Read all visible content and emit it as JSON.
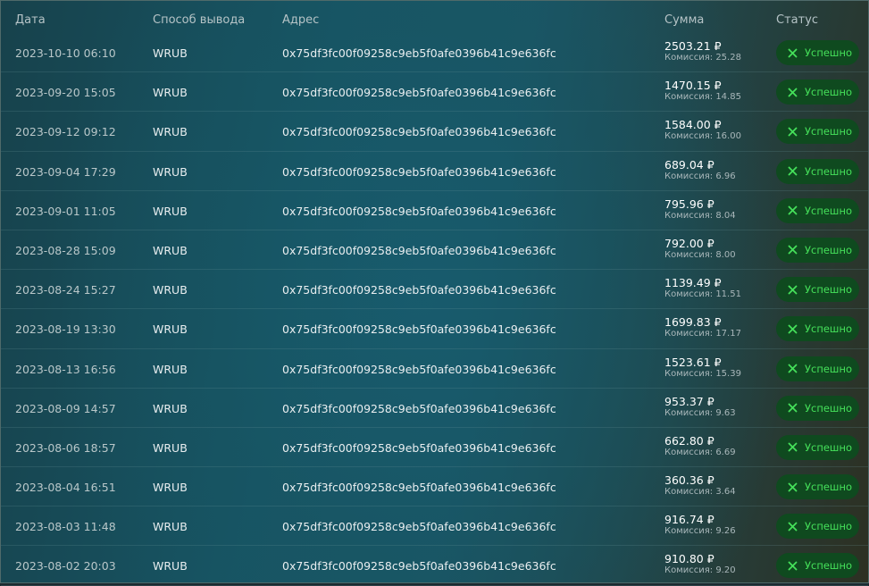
{
  "table": {
    "headers": {
      "date": "Дата",
      "method": "Способ вывода",
      "address": "Адрес",
      "amount": "Сумма",
      "status": "Статус"
    },
    "rows": [
      {
        "date": "2023-10-10 06:10",
        "method": "WRUB",
        "address": "0x75df3fc00f09258c9eb5f0afe0396b41c9e636fc",
        "amount": "2503.21 ₽",
        "fee": "Комиссия: 25.28",
        "status": "Успешно"
      },
      {
        "date": "2023-09-20 15:05",
        "method": "WRUB",
        "address": "0x75df3fc00f09258c9eb5f0afe0396b41c9e636fc",
        "amount": "1470.15 ₽",
        "fee": "Комиссия: 14.85",
        "status": "Успешно"
      },
      {
        "date": "2023-09-12 09:12",
        "method": "WRUB",
        "address": "0x75df3fc00f09258c9eb5f0afe0396b41c9e636fc",
        "amount": "1584.00 ₽",
        "fee": "Комиссия: 16.00",
        "status": "Успешно"
      },
      {
        "date": "2023-09-04 17:29",
        "method": "WRUB",
        "address": "0x75df3fc00f09258c9eb5f0afe0396b41c9e636fc",
        "amount": "689.04 ₽",
        "fee": "Комиссия: 6.96",
        "status": "Успешно"
      },
      {
        "date": "2023-09-01 11:05",
        "method": "WRUB",
        "address": "0x75df3fc00f09258c9eb5f0afe0396b41c9e636fc",
        "amount": "795.96 ₽",
        "fee": "Комиссия: 8.04",
        "status": "Успешно"
      },
      {
        "date": "2023-08-28 15:09",
        "method": "WRUB",
        "address": "0x75df3fc00f09258c9eb5f0afe0396b41c9e636fc",
        "amount": "792.00 ₽",
        "fee": "Комиссия: 8.00",
        "status": "Успешно"
      },
      {
        "date": "2023-08-24 15:27",
        "method": "WRUB",
        "address": "0x75df3fc00f09258c9eb5f0afe0396b41c9e636fc",
        "amount": "1139.49 ₽",
        "fee": "Комиссия: 11.51",
        "status": "Успешно"
      },
      {
        "date": "2023-08-19 13:30",
        "method": "WRUB",
        "address": "0x75df3fc00f09258c9eb5f0afe0396b41c9e636fc",
        "amount": "1699.83 ₽",
        "fee": "Комиссия: 17.17",
        "status": "Успешно"
      },
      {
        "date": "2023-08-13 16:56",
        "method": "WRUB",
        "address": "0x75df3fc00f09258c9eb5f0afe0396b41c9e636fc",
        "amount": "1523.61 ₽",
        "fee": "Комиссия: 15.39",
        "status": "Успешно"
      },
      {
        "date": "2023-08-09 14:57",
        "method": "WRUB",
        "address": "0x75df3fc00f09258c9eb5f0afe0396b41c9e636fc",
        "amount": "953.37 ₽",
        "fee": "Комиссия: 9.63",
        "status": "Успешно"
      },
      {
        "date": "2023-08-06 18:57",
        "method": "WRUB",
        "address": "0x75df3fc00f09258c9eb5f0afe0396b41c9e636fc",
        "amount": "662.80 ₽",
        "fee": "Комиссия: 6.69",
        "status": "Успешно"
      },
      {
        "date": "2023-08-04 16:51",
        "method": "WRUB",
        "address": "0x75df3fc00f09258c9eb5f0afe0396b41c9e636fc",
        "amount": "360.36 ₽",
        "fee": "Комиссия: 3.64",
        "status": "Успешно"
      },
      {
        "date": "2023-08-03 11:48",
        "method": "WRUB",
        "address": "0x75df3fc00f09258c9eb5f0afe0396b41c9e636fc",
        "amount": "916.74 ₽",
        "fee": "Комиссия: 9.26",
        "status": "Успешно"
      },
      {
        "date": "2023-08-02 20:03",
        "method": "WRUB",
        "address": "0x75df3fc00f09258c9eb5f0afe0396b41c9e636fc",
        "amount": "910.80 ₽",
        "fee": "Комиссия: 9.20",
        "status": "Успешно"
      }
    ]
  },
  "colors": {
    "status_bg": "#0f4a1f",
    "status_text": "#45e05a"
  },
  "icons": {
    "status": "x-icon"
  }
}
